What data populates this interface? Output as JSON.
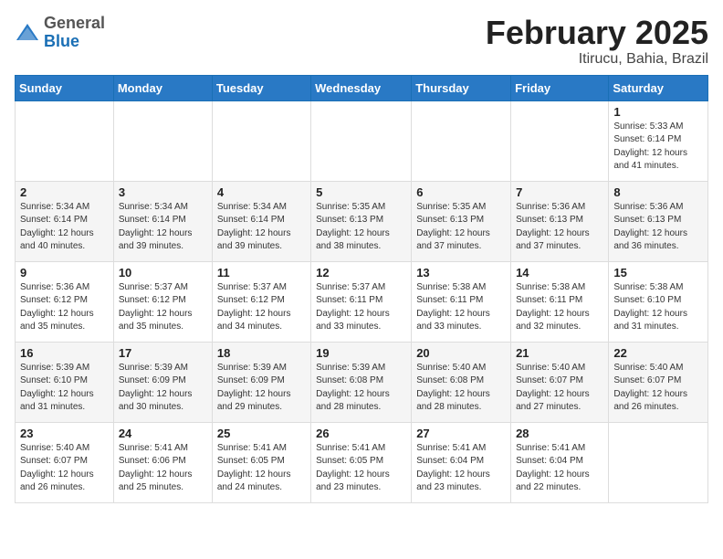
{
  "header": {
    "logo_general": "General",
    "logo_blue": "Blue",
    "month_year": "February 2025",
    "location": "Itirucu, Bahia, Brazil"
  },
  "days_of_week": [
    "Sunday",
    "Monday",
    "Tuesday",
    "Wednesday",
    "Thursday",
    "Friday",
    "Saturday"
  ],
  "weeks": [
    [
      {
        "day": "",
        "info": ""
      },
      {
        "day": "",
        "info": ""
      },
      {
        "day": "",
        "info": ""
      },
      {
        "day": "",
        "info": ""
      },
      {
        "day": "",
        "info": ""
      },
      {
        "day": "",
        "info": ""
      },
      {
        "day": "1",
        "info": "Sunrise: 5:33 AM\nSunset: 6:14 PM\nDaylight: 12 hours\nand 41 minutes."
      }
    ],
    [
      {
        "day": "2",
        "info": "Sunrise: 5:34 AM\nSunset: 6:14 PM\nDaylight: 12 hours\nand 40 minutes."
      },
      {
        "day": "3",
        "info": "Sunrise: 5:34 AM\nSunset: 6:14 PM\nDaylight: 12 hours\nand 39 minutes."
      },
      {
        "day": "4",
        "info": "Sunrise: 5:34 AM\nSunset: 6:14 PM\nDaylight: 12 hours\nand 39 minutes."
      },
      {
        "day": "5",
        "info": "Sunrise: 5:35 AM\nSunset: 6:13 PM\nDaylight: 12 hours\nand 38 minutes."
      },
      {
        "day": "6",
        "info": "Sunrise: 5:35 AM\nSunset: 6:13 PM\nDaylight: 12 hours\nand 37 minutes."
      },
      {
        "day": "7",
        "info": "Sunrise: 5:36 AM\nSunset: 6:13 PM\nDaylight: 12 hours\nand 37 minutes."
      },
      {
        "day": "8",
        "info": "Sunrise: 5:36 AM\nSunset: 6:13 PM\nDaylight: 12 hours\nand 36 minutes."
      }
    ],
    [
      {
        "day": "9",
        "info": "Sunrise: 5:36 AM\nSunset: 6:12 PM\nDaylight: 12 hours\nand 35 minutes."
      },
      {
        "day": "10",
        "info": "Sunrise: 5:37 AM\nSunset: 6:12 PM\nDaylight: 12 hours\nand 35 minutes."
      },
      {
        "day": "11",
        "info": "Sunrise: 5:37 AM\nSunset: 6:12 PM\nDaylight: 12 hours\nand 34 minutes."
      },
      {
        "day": "12",
        "info": "Sunrise: 5:37 AM\nSunset: 6:11 PM\nDaylight: 12 hours\nand 33 minutes."
      },
      {
        "day": "13",
        "info": "Sunrise: 5:38 AM\nSunset: 6:11 PM\nDaylight: 12 hours\nand 33 minutes."
      },
      {
        "day": "14",
        "info": "Sunrise: 5:38 AM\nSunset: 6:11 PM\nDaylight: 12 hours\nand 32 minutes."
      },
      {
        "day": "15",
        "info": "Sunrise: 5:38 AM\nSunset: 6:10 PM\nDaylight: 12 hours\nand 31 minutes."
      }
    ],
    [
      {
        "day": "16",
        "info": "Sunrise: 5:39 AM\nSunset: 6:10 PM\nDaylight: 12 hours\nand 31 minutes."
      },
      {
        "day": "17",
        "info": "Sunrise: 5:39 AM\nSunset: 6:09 PM\nDaylight: 12 hours\nand 30 minutes."
      },
      {
        "day": "18",
        "info": "Sunrise: 5:39 AM\nSunset: 6:09 PM\nDaylight: 12 hours\nand 29 minutes."
      },
      {
        "day": "19",
        "info": "Sunrise: 5:39 AM\nSunset: 6:08 PM\nDaylight: 12 hours\nand 28 minutes."
      },
      {
        "day": "20",
        "info": "Sunrise: 5:40 AM\nSunset: 6:08 PM\nDaylight: 12 hours\nand 28 minutes."
      },
      {
        "day": "21",
        "info": "Sunrise: 5:40 AM\nSunset: 6:07 PM\nDaylight: 12 hours\nand 27 minutes."
      },
      {
        "day": "22",
        "info": "Sunrise: 5:40 AM\nSunset: 6:07 PM\nDaylight: 12 hours\nand 26 minutes."
      }
    ],
    [
      {
        "day": "23",
        "info": "Sunrise: 5:40 AM\nSunset: 6:07 PM\nDaylight: 12 hours\nand 26 minutes."
      },
      {
        "day": "24",
        "info": "Sunrise: 5:41 AM\nSunset: 6:06 PM\nDaylight: 12 hours\nand 25 minutes."
      },
      {
        "day": "25",
        "info": "Sunrise: 5:41 AM\nSunset: 6:05 PM\nDaylight: 12 hours\nand 24 minutes."
      },
      {
        "day": "26",
        "info": "Sunrise: 5:41 AM\nSunset: 6:05 PM\nDaylight: 12 hours\nand 23 minutes."
      },
      {
        "day": "27",
        "info": "Sunrise: 5:41 AM\nSunset: 6:04 PM\nDaylight: 12 hours\nand 23 minutes."
      },
      {
        "day": "28",
        "info": "Sunrise: 5:41 AM\nSunset: 6:04 PM\nDaylight: 12 hours\nand 22 minutes."
      },
      {
        "day": "",
        "info": ""
      }
    ]
  ]
}
